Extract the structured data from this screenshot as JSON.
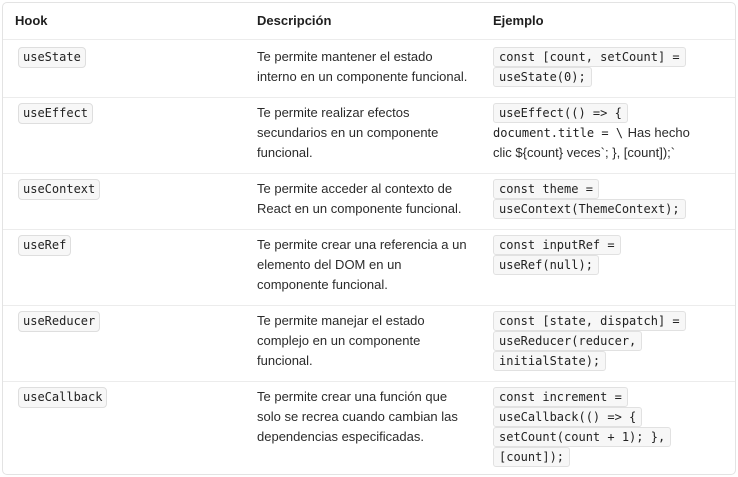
{
  "table": {
    "headers": {
      "hook": "Hook",
      "description": "Descripción",
      "example": "Ejemplo"
    },
    "rows": [
      {
        "hook": "useState",
        "description": [
          "Te permite mantener el estado",
          "interno en un componente funcional."
        ],
        "example": [
          "const [count, setCount] =",
          "useState(0);"
        ]
      },
      {
        "hook": "useEffect",
        "description": [
          "Te permite realizar efectos",
          "secundarios en un componente",
          "funcional."
        ],
        "example": [
          "useEffect(() => {",
          "document.title = \\",
          "clic ${count} veces`; }, [count]);`"
        ],
        "example_plain_suffix": "Has hecho"
      },
      {
        "hook": "useContext",
        "description": [
          "Te permite acceder al contexto de",
          "React en un componente funcional."
        ],
        "example": [
          "const theme =",
          "useContext(ThemeContext);"
        ]
      },
      {
        "hook": "useRef",
        "description": [
          "Te permite crear una referencia a un",
          "elemento del DOM en un",
          "componente funcional."
        ],
        "example": [
          "const inputRef =",
          "useRef(null);"
        ]
      },
      {
        "hook": "useReducer",
        "description": [
          "Te permite manejar el estado",
          "complejo en un componente",
          "funcional."
        ],
        "example": [
          "const [state, dispatch] =",
          "useReducer(reducer,",
          "initialState);"
        ]
      },
      {
        "hook": "useCallback",
        "description": [
          "Te permite crear una función que",
          "solo se recrea cuando cambian las",
          "dependencias especificadas."
        ],
        "example": [
          "const increment =",
          "useCallback(() => {",
          "setCount(count + 1); },",
          "[count]);"
        ]
      }
    ]
  }
}
